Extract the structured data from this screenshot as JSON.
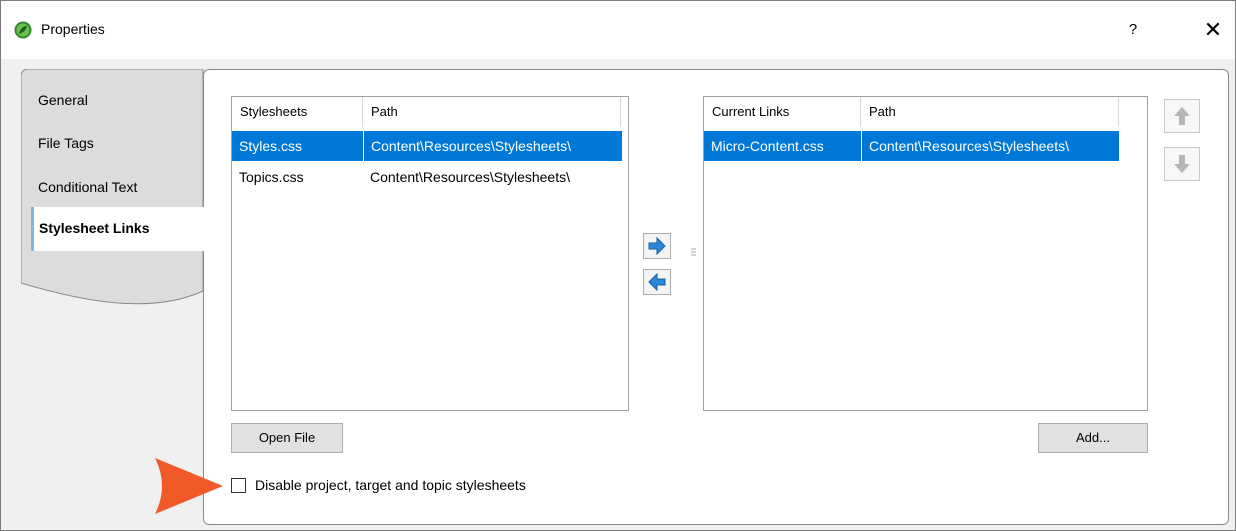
{
  "window": {
    "title": "Properties",
    "help_label": "?",
    "close_label": "✕"
  },
  "tabs": [
    {
      "label": "General"
    },
    {
      "label": "File Tags"
    },
    {
      "label": "Conditional Text"
    },
    {
      "label": "Stylesheet Links"
    }
  ],
  "stylesheets_list": {
    "headers": [
      "Stylesheets",
      "Path"
    ],
    "rows": [
      {
        "name": "Styles.css",
        "path": "Content\\Resources\\Stylesheets\\",
        "selected": true
      },
      {
        "name": "Topics.css",
        "path": "Content\\Resources\\Stylesheets\\",
        "selected": false
      }
    ]
  },
  "links_list": {
    "headers": [
      "Current Links",
      "Path"
    ],
    "rows": [
      {
        "name": "Micro-Content.css",
        "path": "Content\\Resources\\Stylesheets\\",
        "selected": true
      }
    ]
  },
  "buttons": {
    "open_file": "Open File",
    "add": "Add..."
  },
  "checkbox": {
    "label": "Disable project, target and topic stylesheets",
    "checked": false
  },
  "colors": {
    "selection": "#0078d7",
    "callout": "#f05a28",
    "arrow": "#2b88d8",
    "app_icon": "#3aa53a"
  },
  "icons": [
    "app-logo-icon",
    "help-icon",
    "close-icon",
    "arrow-right-icon",
    "arrow-left-icon",
    "arrow-up-icon",
    "arrow-down-icon",
    "callout-arrow-icon"
  ]
}
